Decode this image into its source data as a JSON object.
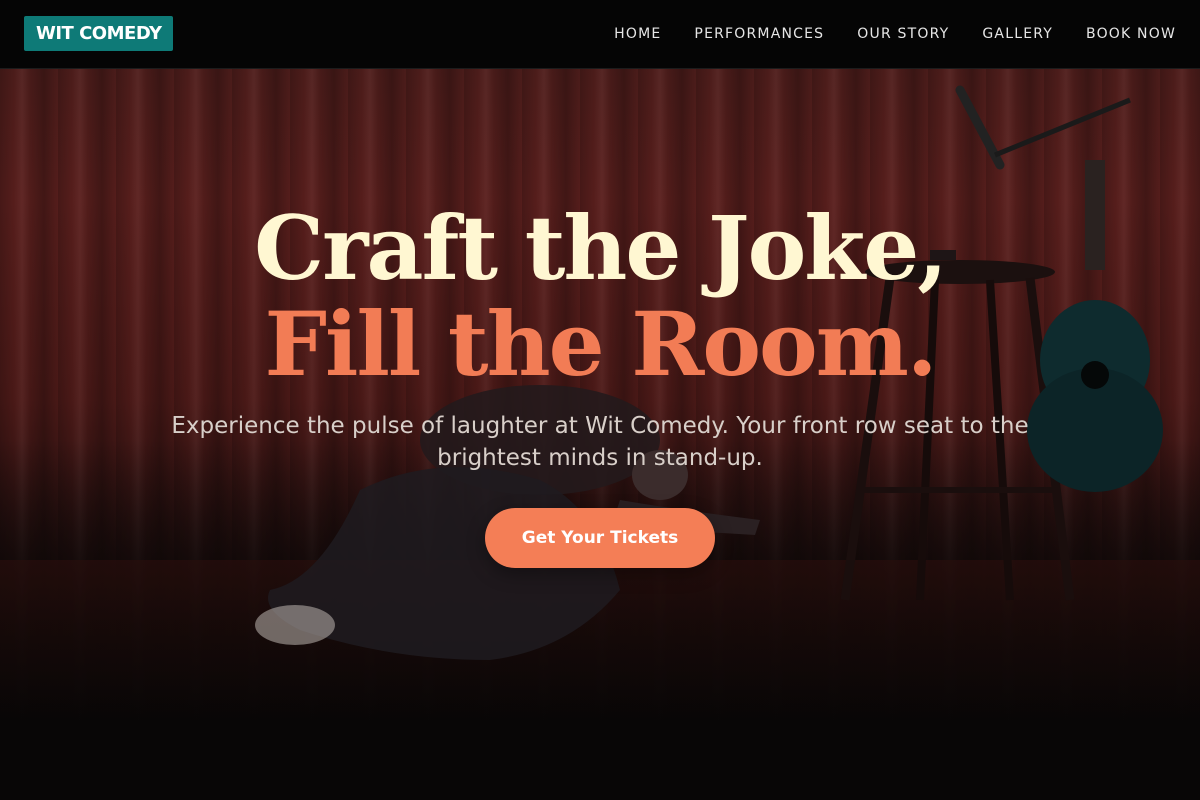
{
  "brand": {
    "logo_text": "WIT COMEDY",
    "logo_color": "#0e7a77"
  },
  "nav": {
    "items": [
      {
        "label": "HOME"
      },
      {
        "label": "PERFORMANCES"
      },
      {
        "label": "OUR STORY"
      },
      {
        "label": "GALLERY"
      },
      {
        "label": "BOOK NOW"
      }
    ]
  },
  "hero": {
    "headline_line1": "Craft the Joke,",
    "headline_line2": "Fill the Room.",
    "subtitle": "Experience the pulse of laughter at Wit Comedy. Your front row seat to the brightest minds in stand-up.",
    "cta_label": "Get Your Tickets",
    "headline_color_primary": "#fff7d2",
    "headline_color_accent": "#f27c55",
    "cta_color": "#f47e56"
  }
}
